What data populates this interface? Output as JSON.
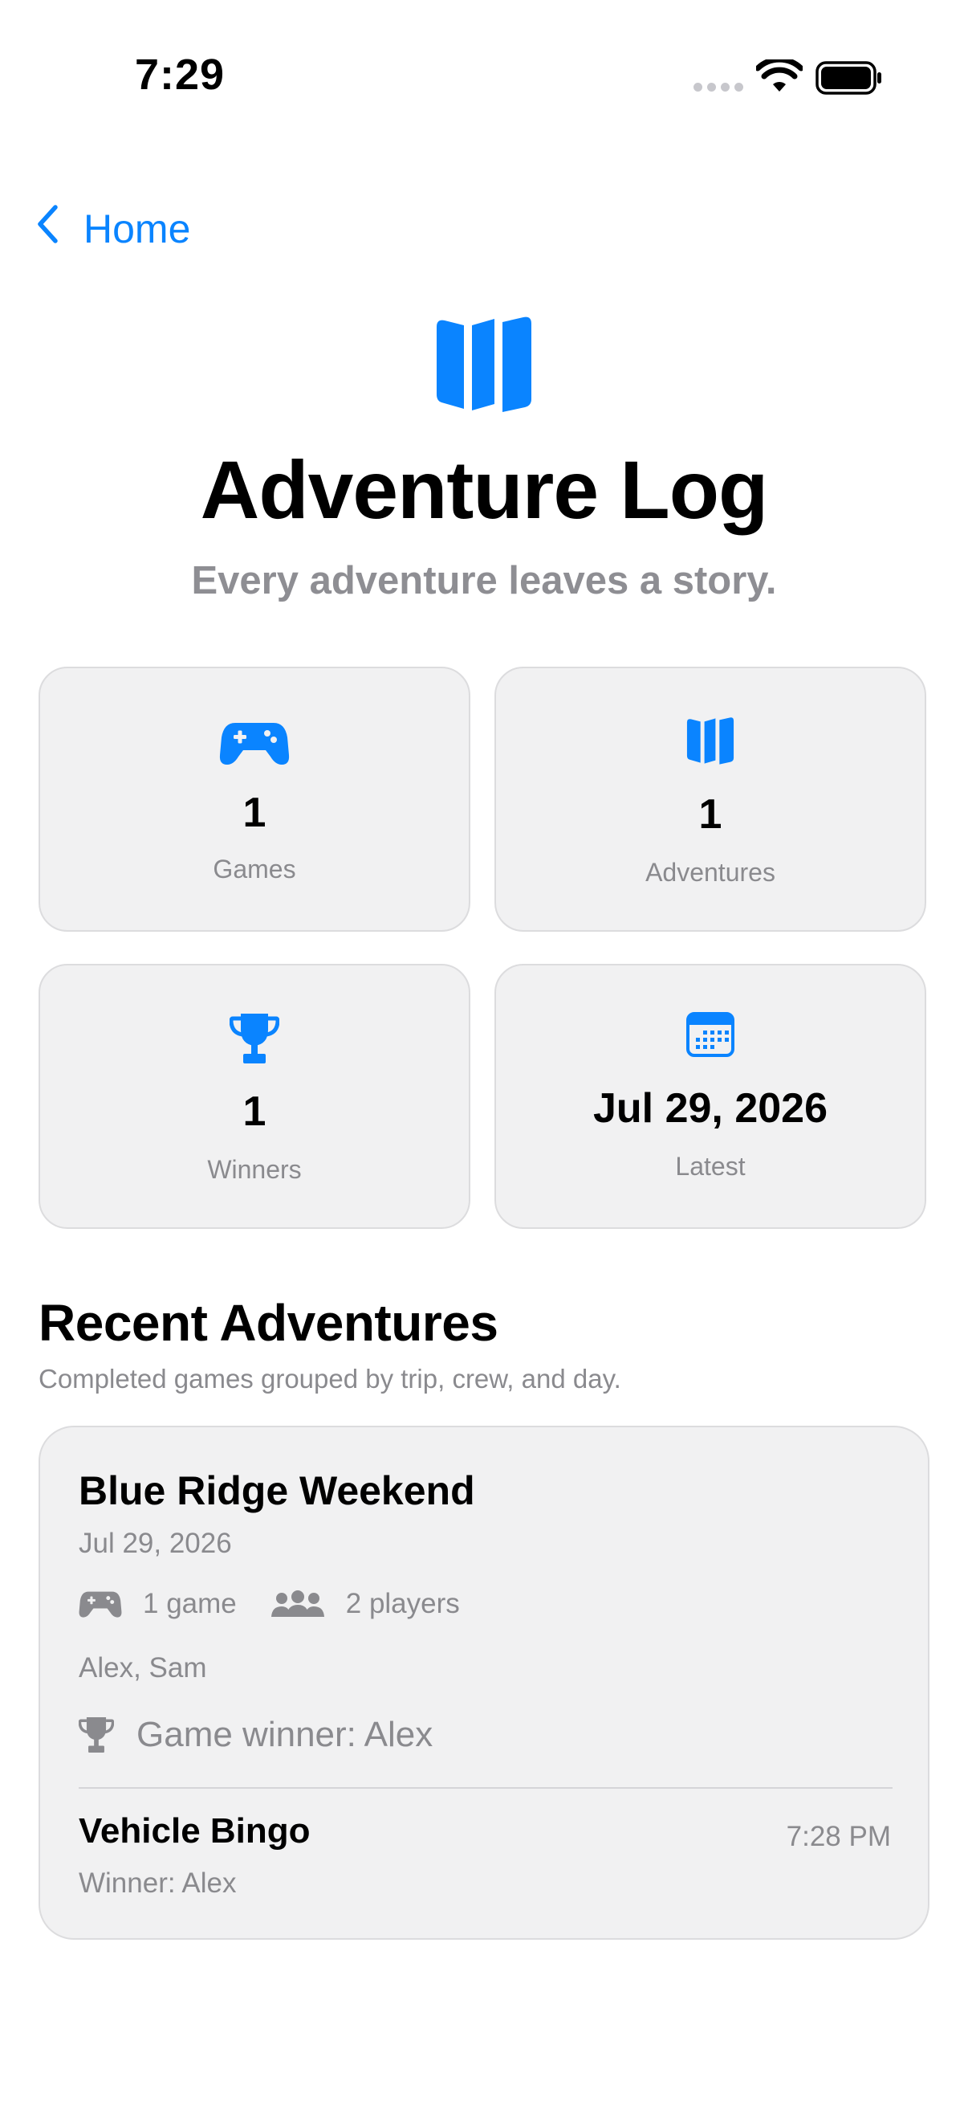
{
  "status_bar": {
    "time": "7:29"
  },
  "nav": {
    "back_label": "Home"
  },
  "hero": {
    "icon": "map-icon",
    "title": "Adventure Log",
    "subtitle": "Every adventure leaves a story."
  },
  "stats": [
    {
      "icon": "gamecontroller-icon",
      "value": "1",
      "label": "Games"
    },
    {
      "icon": "map-icon",
      "value": "1",
      "label": "Adventures"
    },
    {
      "icon": "trophy-icon",
      "value": "1",
      "label": "Winners"
    },
    {
      "icon": "calendar-icon",
      "value": "Jul 29, 2026",
      "label": "Latest"
    }
  ],
  "recent": {
    "title": "Recent Adventures",
    "subtitle": "Completed games grouped by trip, crew, and day.",
    "adventures": [
      {
        "title": "Blue Ridge Weekend",
        "date": "Jul 29, 2026",
        "games_count": "1 game",
        "players_count": "2 players",
        "players": "Alex, Sam",
        "winner": "Game winner: Alex",
        "games": [
          {
            "name": "Vehicle Bingo",
            "winner": "Winner: Alex",
            "time": "7:28 PM"
          }
        ]
      }
    ]
  },
  "colors": {
    "accent": "#0a84ff",
    "card_bg": "#f1f1f2",
    "secondary_text": "#8a8a8e"
  }
}
